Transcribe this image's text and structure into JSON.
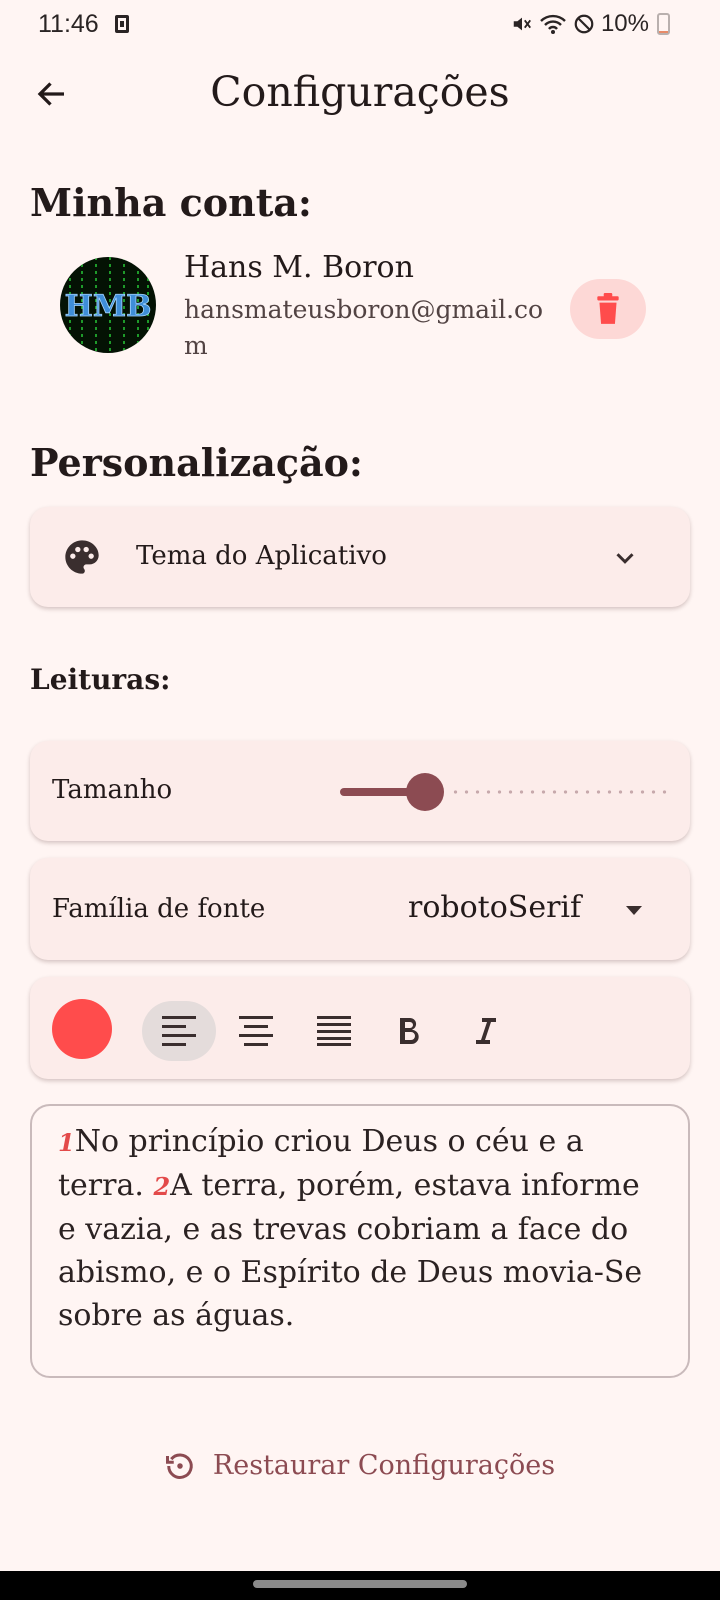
{
  "status_bar": {
    "time": "11:46",
    "battery": "10%",
    "battery_level": 0.1
  },
  "app_bar": {
    "title": "Configurações"
  },
  "account": {
    "heading": "Minha conta:",
    "name": "Hans M. Boron",
    "email": "hansmateusboron@gmail.com",
    "avatar_text": "HMB"
  },
  "personalization": {
    "heading": "Personalização:",
    "theme_label": "Tema do Aplicativo"
  },
  "readings": {
    "heading": "Leituras:",
    "size_label": "Tamanho",
    "size_slider_value": 0.27,
    "font_family_label": "Família de fonte",
    "font_family_value": "robotoSerif",
    "text_color": "#ff4c4c",
    "alignment_selected": "left",
    "preview": {
      "verse1_num": "1",
      "verse1_text": "No princípio criou Deus o céu e a terra. ",
      "verse2_num": "2",
      "verse2_text": "A terra, porém, estava informe e vazia, e as trevas cobriam a face do abismo, e o Espírito de Deus movia-Se sobre as águas."
    }
  },
  "restore_label": "Restaurar Configurações",
  "colors": {
    "accent": "#8c4b52",
    "background": "#fff5f3",
    "card": "#fcecea",
    "danger": "#ff4c4c"
  }
}
